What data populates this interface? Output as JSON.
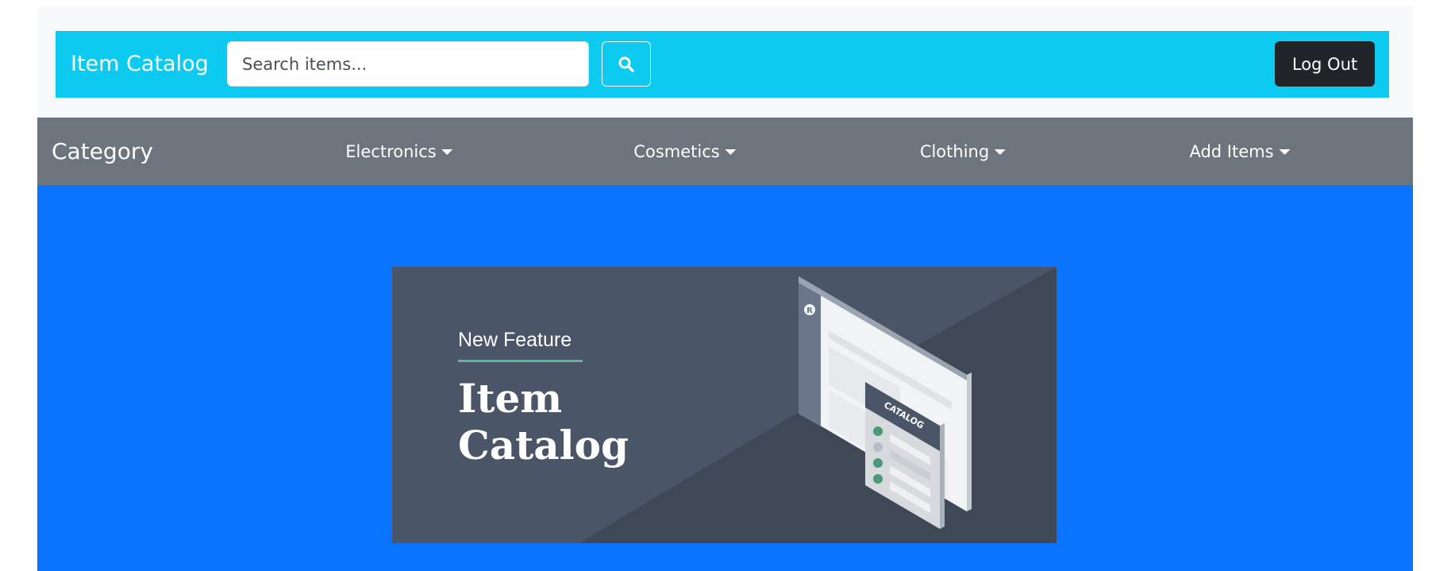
{
  "header": {
    "brand": "Item Catalog",
    "search_placeholder": "Search items...",
    "search_value": "",
    "logout_label": "Log Out"
  },
  "category_nav": {
    "title": "Category",
    "items": [
      {
        "label": "Electronics",
        "icon": "caret-down-icon"
      },
      {
        "label": "Cosmetics",
        "icon": "caret-down-icon"
      },
      {
        "label": "Clothing",
        "icon": "caret-down-icon"
      },
      {
        "label": "Add Items",
        "icon": "caret-down-icon"
      }
    ]
  },
  "banner": {
    "subtitle": "New Feature",
    "title_line1": "Item",
    "title_line2": "Catalog",
    "card_label": "CATALOG",
    "app_badge_letter": "R"
  },
  "colors": {
    "header_bg": "#0dcaf0",
    "category_bg": "#6c757d",
    "hero_bg": "#0a74ff",
    "banner_bg": "#4a5567",
    "logout_bg": "#212529",
    "accent_rule": "#5fb59a"
  }
}
